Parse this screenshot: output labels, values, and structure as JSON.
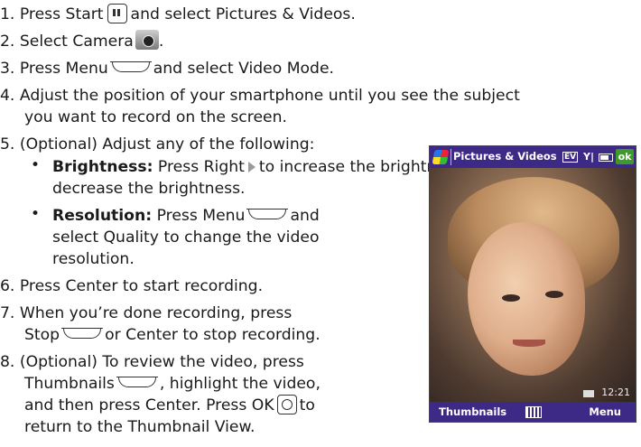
{
  "steps": {
    "s1_a": "1. Press Start",
    "s1_b": "and select Pictures & Videos.",
    "s2": "2. Select Camera",
    "s2_end": ".",
    "s3_a": "3. Press Menu",
    "s3_b": "and select Video Mode.",
    "s4_a": "4. Adjust the position of your smartphone until you see the subject",
    "s4_b": "you want to record on the screen.",
    "s5": "5. (Optional) Adjust any of the following:",
    "b1_label": "Brightness:",
    "b1_a": "Press Right",
    "b1_b": "to increase the brightness or Left",
    "b1_c": "to",
    "b1_d": "decrease the brightness.",
    "b2_label": "Resolution:",
    "b2_a": "Press Menu",
    "b2_b": "and",
    "b2_c": "select Quality to change the video",
    "b2_d": "resolution.",
    "s6": "6. Press Center to start recording.",
    "s7_a": "7. When you’re done recording, press",
    "s7_b": "Stop",
    "s7_c": "or Center to stop recording.",
    "s8_a": "8. (Optional) To review the video, press",
    "s8_b": "Thumbnails",
    "s8_c": ", highlight the video,",
    "s8_d": "and then press Center. Press OK",
    "s8_e": "to",
    "s8_f": "return to the Thumbnail View."
  },
  "phone": {
    "title": "Pictures & Videos",
    "ev_badge": "EV",
    "ok_label": "ok",
    "time": "12:21",
    "left_soft": "Thumbnails",
    "right_soft": "Menu"
  }
}
